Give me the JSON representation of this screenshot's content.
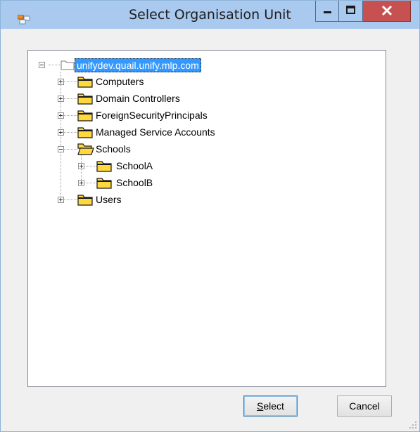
{
  "window": {
    "title": "Select Organisation Unit",
    "icons": {
      "app": "app-icon",
      "minimize": "minimize-icon",
      "maximize": "maximize-icon",
      "close": "close-icon"
    }
  },
  "tree": {
    "root": {
      "label": "unifydev.quail.unify.mlp.com",
      "expanded": true,
      "selected": true,
      "icon": "folder-icon"
    },
    "children": [
      {
        "label": "Computers",
        "expanded": false
      },
      {
        "label": "Domain Controllers",
        "expanded": false
      },
      {
        "label": "ForeignSecurityPrincipals",
        "expanded": false
      },
      {
        "label": "Managed Service Accounts",
        "expanded": false
      },
      {
        "label": "Schools",
        "expanded": true,
        "children": [
          {
            "label": "SchoolA",
            "expanded": false
          },
          {
            "label": "SchoolB",
            "expanded": false
          }
        ]
      },
      {
        "label": "Users",
        "expanded": false
      }
    ]
  },
  "buttons": {
    "select_label": "Select",
    "select_mnemonic": "S",
    "select_rest": "elect",
    "cancel_label": "Cancel"
  },
  "colors": {
    "titlebar": "#a9c9ef",
    "close_button": "#c75050",
    "selection": "#3399ff",
    "folder_fill": "#ffd83f"
  }
}
